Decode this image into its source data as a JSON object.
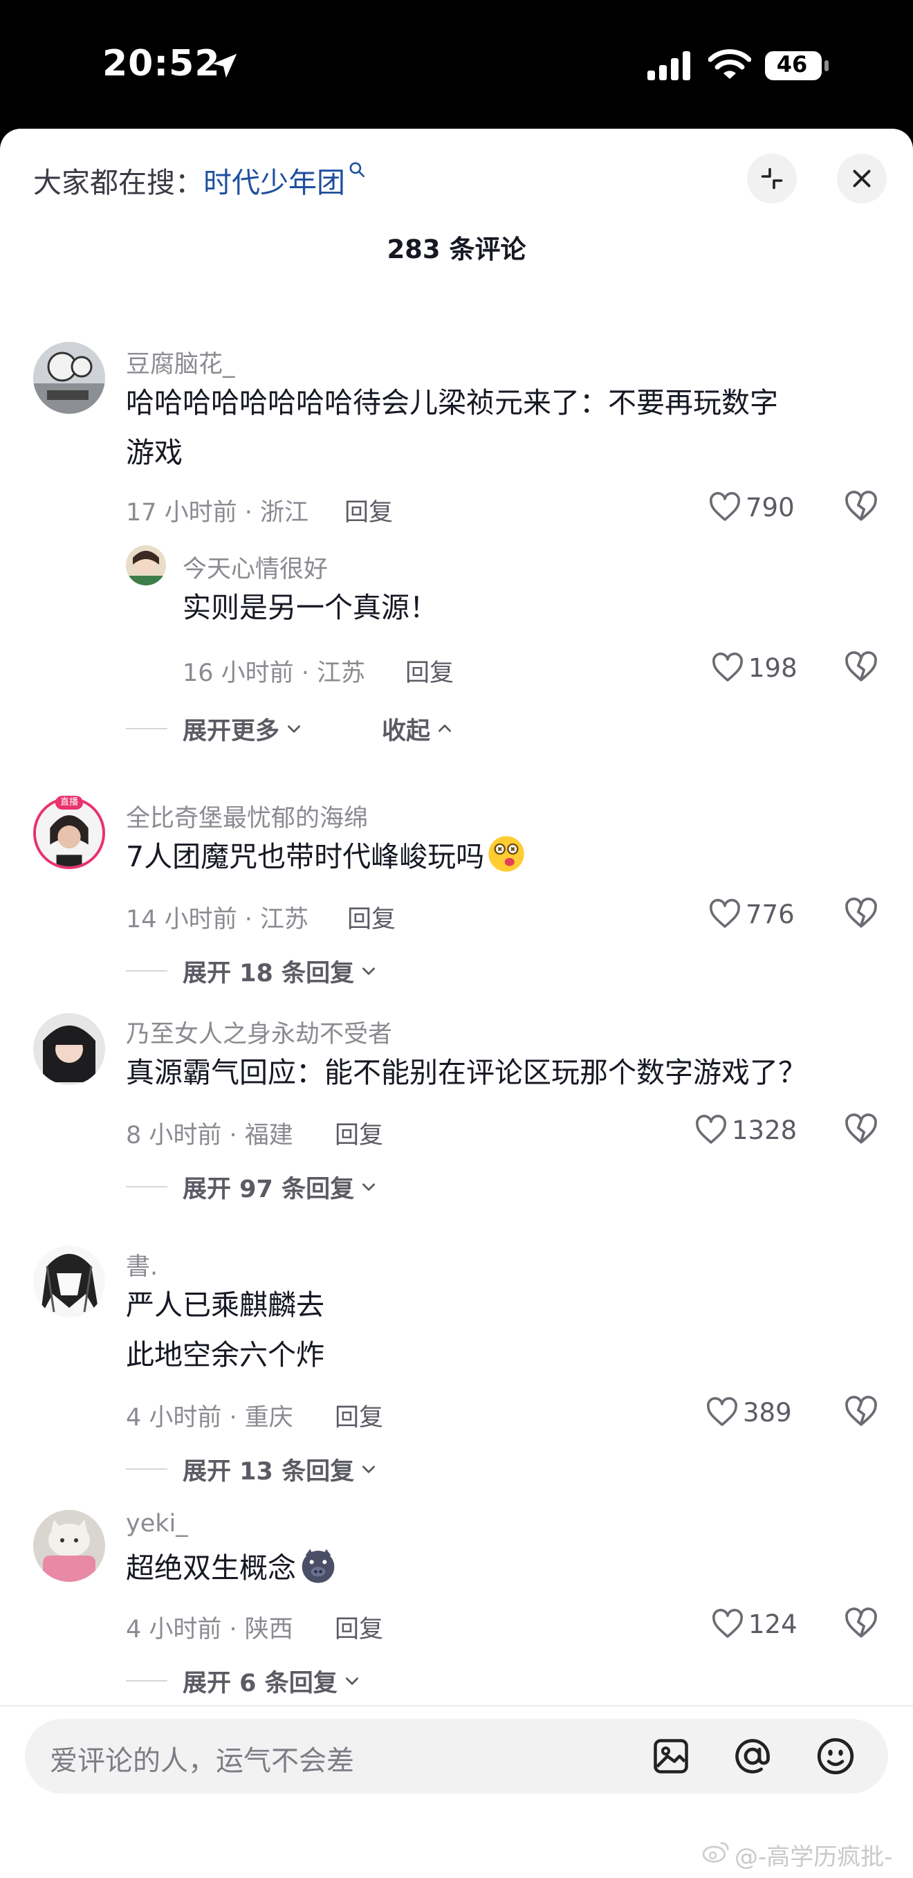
{
  "status_bar": {
    "time": "20:52",
    "battery": "46"
  },
  "header": {
    "search_prefix": "大家都在搜：",
    "search_term": "时代少年团",
    "comment_count": "283 条评论"
  },
  "comments": [
    {
      "username": "豆腐脑花_",
      "text_lines": [
        "哈哈哈哈哈哈哈哈待会儿梁祯元来了：不要再玩数字",
        "游戏"
      ],
      "time_location": "17 小时前 · 浙江",
      "reply_label": "回复",
      "likes": "790",
      "reply": {
        "username": "今天心情很好",
        "text": "实则是另一个真源！",
        "time_location": "16 小时前 · 江苏",
        "reply_label": "回复",
        "likes": "198"
      },
      "expand_more": "展开更多",
      "collapse": "收起"
    },
    {
      "username": "全比奇堡最忧郁的海绵",
      "avatar_badge": "直播",
      "text_lines": [
        "7人团魔咒也带时代峰峻玩吗"
      ],
      "time_location": "14 小时前 · 江苏",
      "reply_label": "回复",
      "likes": "776",
      "expand": "展开 18 条回复"
    },
    {
      "username": "乃至女人之身永劫不受者",
      "text_lines": [
        "真源霸气回应：能不能别在评论区玩那个数字游戏了？"
      ],
      "time_location": "8 小时前 · 福建",
      "reply_label": "回复",
      "likes": "1328",
      "expand": "展开 97 条回复"
    },
    {
      "username": "書.",
      "text_lines": [
        "严人已乘麒麟去",
        "此地空余六个炸"
      ],
      "time_location": "4 小时前 · 重庆",
      "reply_label": "回复",
      "likes": "389",
      "expand": "展开 13 条回复"
    },
    {
      "username": "yeki_",
      "text_lines": [
        "超绝双生概念"
      ],
      "time_location": "4 小时前 · 陕西",
      "reply_label": "回复",
      "likes": "124",
      "expand": "展开 6 条回复"
    }
  ],
  "input": {
    "placeholder": "爱评论的人，运气不会差"
  },
  "watermark": "@-高学历疯批-",
  "icons": {
    "location": "location-arrow-icon",
    "signal": "cellular-signal-icon",
    "wifi": "wifi-icon",
    "battery": "battery-icon",
    "collapse": "collapse-arrows-icon",
    "close": "close-icon",
    "like": "heart-icon",
    "dislike": "broken-heart-icon",
    "image": "image-icon",
    "mention": "at-icon",
    "emoji": "emoji-icon"
  },
  "colors": {
    "search_term": "#1e4f9e",
    "live_badge": "#e8336d"
  }
}
